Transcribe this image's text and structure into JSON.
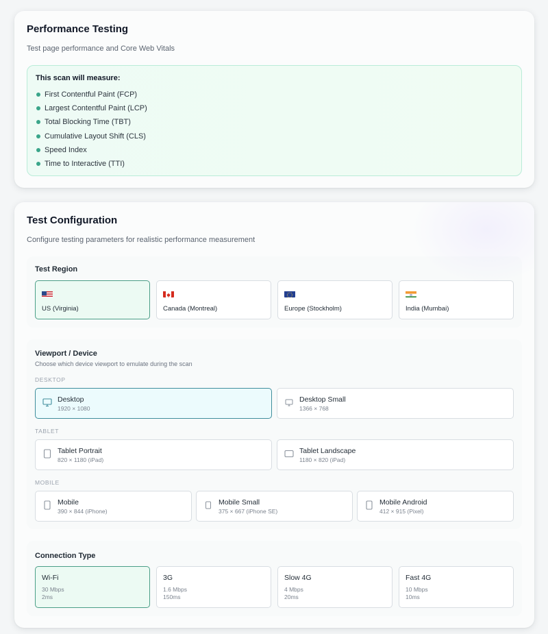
{
  "performance": {
    "title": "Performance Testing",
    "subtitle": "Test page performance and Core Web Vitals",
    "measure_title": "This scan will measure:",
    "metrics": [
      "First Contentful Paint (FCP)",
      "Largest Contentful Paint (LCP)",
      "Total Blocking Time (TBT)",
      "Cumulative Layout Shift (CLS)",
      "Speed Index",
      "Time to Interactive (TTI)"
    ]
  },
  "config": {
    "title": "Test Configuration",
    "subtitle": "Configure testing parameters for realistic performance measurement"
  },
  "region": {
    "label": "Test Region",
    "options": [
      {
        "name": "US (Virginia)",
        "flag": "us-flag-icon",
        "selected": true
      },
      {
        "name": "Canada (Montreal)",
        "flag": "canada-flag-icon",
        "selected": false
      },
      {
        "name": "Europe (Stockholm)",
        "flag": "eu-flag-icon",
        "selected": false
      },
      {
        "name": "India (Mumbai)",
        "flag": "india-flag-icon",
        "selected": false
      }
    ]
  },
  "viewport": {
    "label": "Viewport / Device",
    "description": "Choose which device viewport to emulate during the scan",
    "groups": {
      "desktop": "DESKTOP",
      "tablet": "TABLET",
      "mobile": "MOBILE"
    },
    "desktop": [
      {
        "name": "Desktop",
        "size": "1920 × 1080",
        "icon": "monitor-icon",
        "selected": true
      },
      {
        "name": "Desktop Small",
        "size": "1366 × 768",
        "icon": "monitor-icon",
        "selected": false
      }
    ],
    "tablet": [
      {
        "name": "Tablet Portrait",
        "size": "820 × 1180 (iPad)",
        "icon": "tablet-icon",
        "selected": false
      },
      {
        "name": "Tablet Landscape",
        "size": "1180 × 820 (iPad)",
        "icon": "tablet-landscape-icon",
        "selected": false
      }
    ],
    "mobile": [
      {
        "name": "Mobile",
        "size": "390 × 844 (iPhone)",
        "icon": "phone-icon",
        "selected": false
      },
      {
        "name": "Mobile Small",
        "size": "375 × 667 (iPhone SE)",
        "icon": "phone-icon",
        "selected": false
      },
      {
        "name": "Mobile Android",
        "size": "412 × 915 (Pixel)",
        "icon": "phone-icon",
        "selected": false
      }
    ]
  },
  "connection": {
    "label": "Connection Type",
    "options": [
      {
        "name": "Wi-Fi",
        "speed": "30 Mbps",
        "latency": "2ms",
        "selected": true
      },
      {
        "name": "3G",
        "speed": "1.6 Mbps",
        "latency": "150ms",
        "selected": false
      },
      {
        "name": "Slow 4G",
        "speed": "4 Mbps",
        "latency": "20ms",
        "selected": false
      },
      {
        "name": "Fast 4G",
        "speed": "10 Mbps",
        "latency": "10ms",
        "selected": false
      }
    ]
  },
  "colors": {
    "accent_green": "#4b9e87",
    "accent_teal": "#3f8d9c",
    "bullet": "#3aa58a"
  }
}
